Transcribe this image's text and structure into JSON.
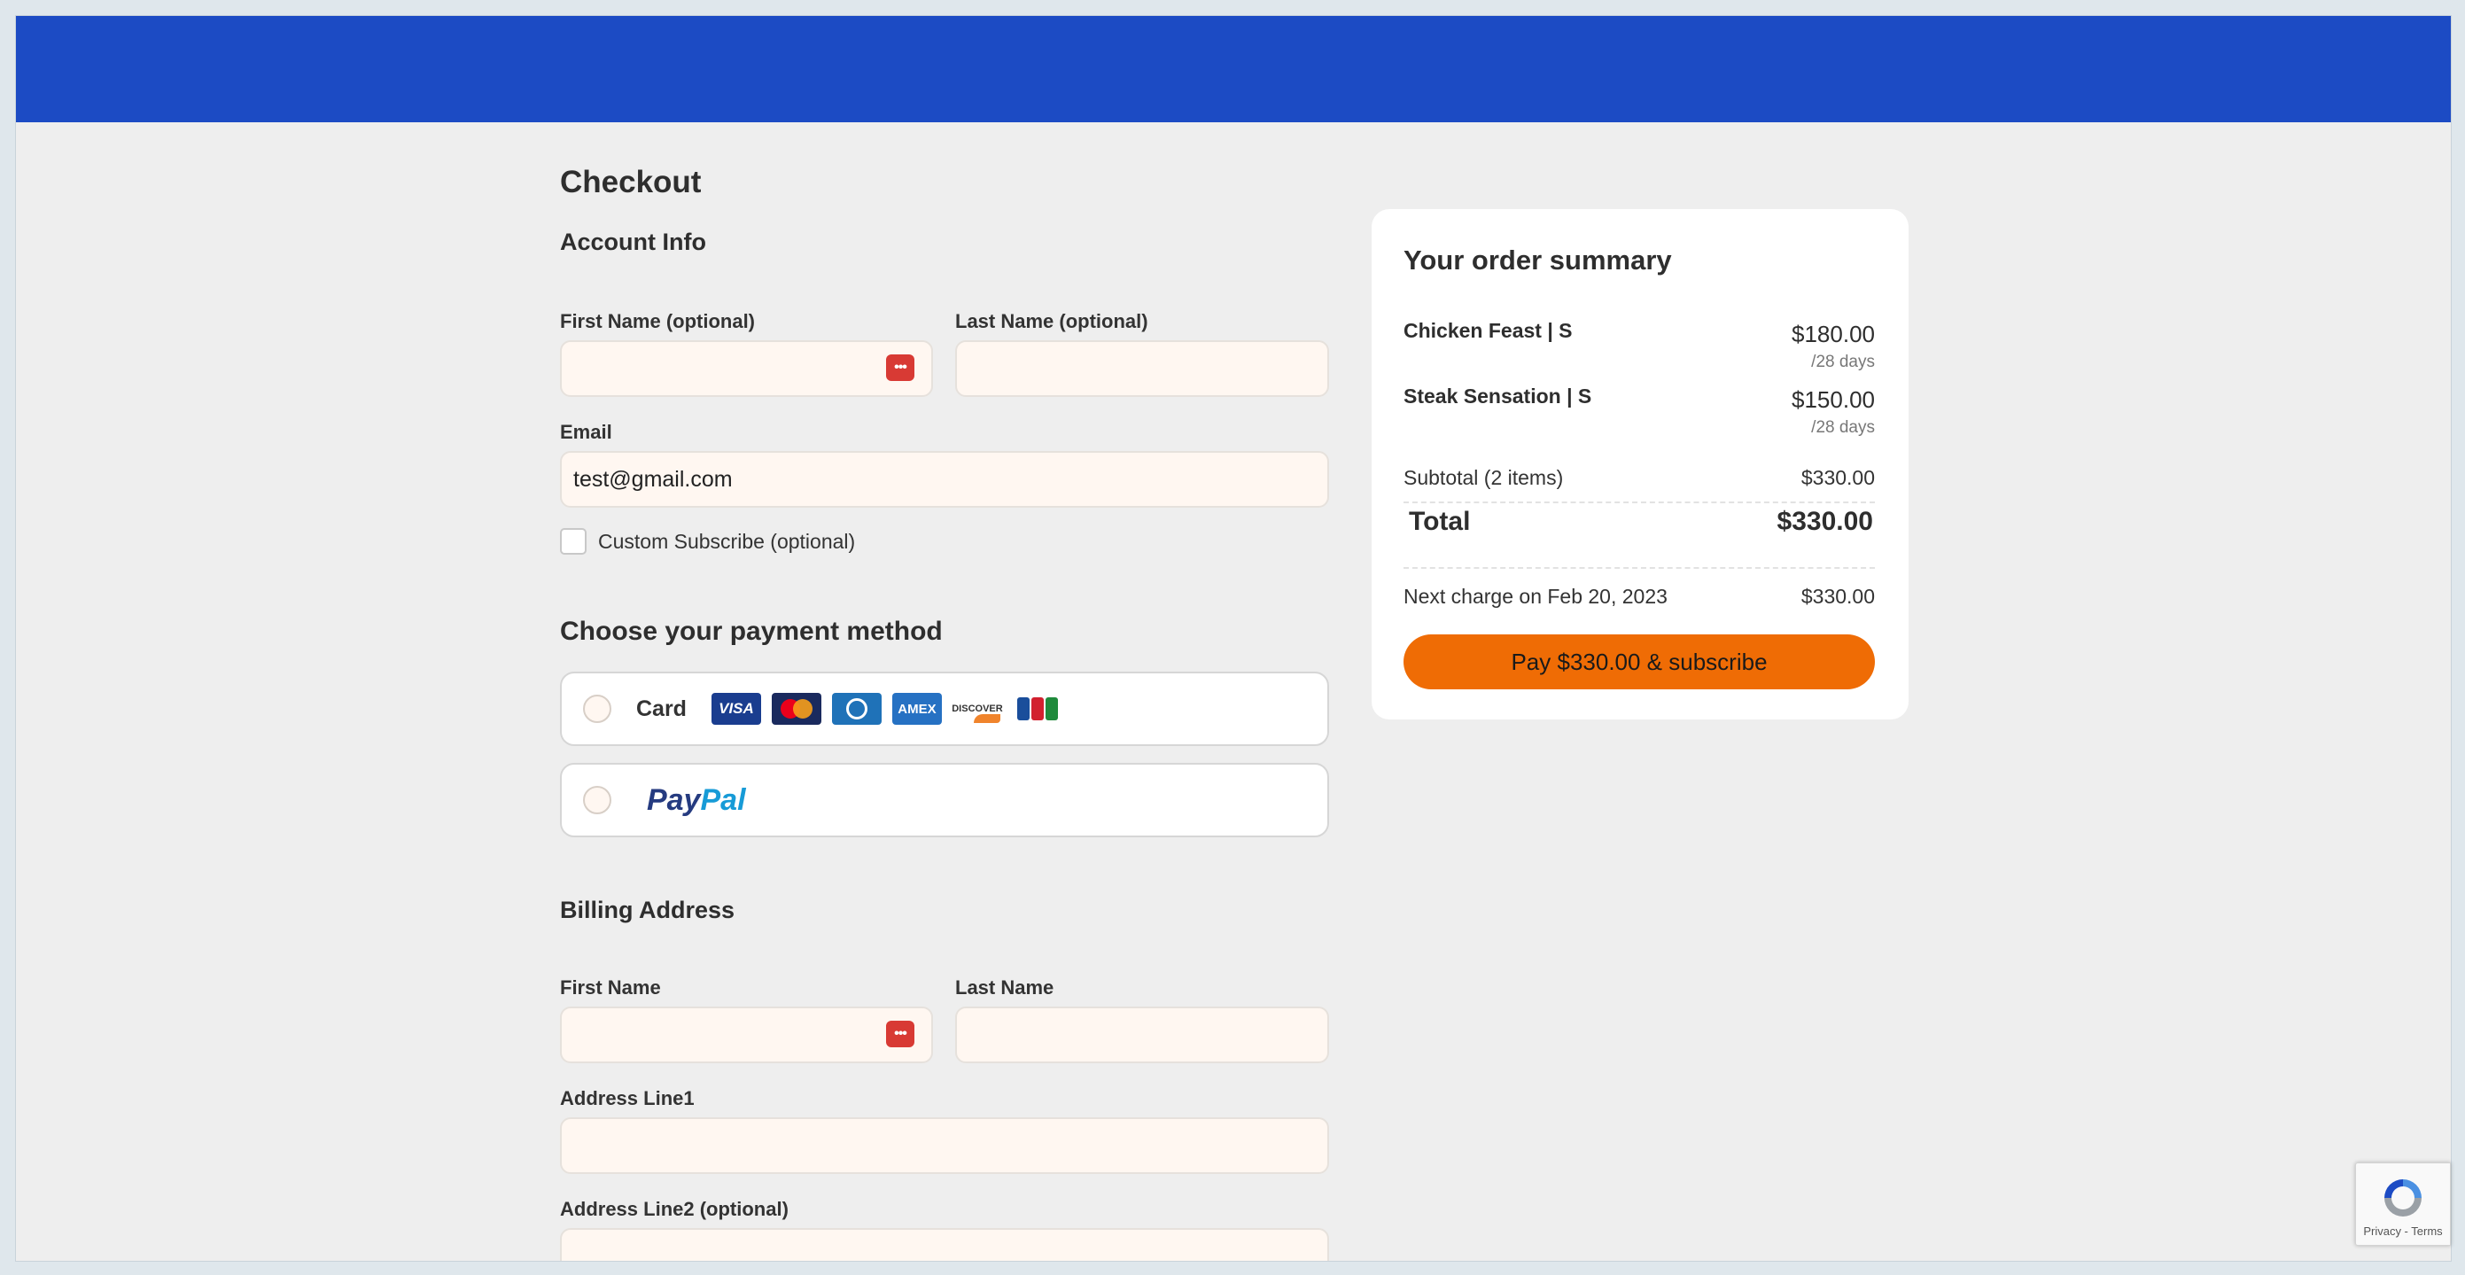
{
  "checkout": {
    "title": "Checkout",
    "account_info": {
      "heading": "Account Info",
      "first_name_label": "First Name (optional)",
      "first_name_value": "",
      "last_name_label": "Last Name (optional)",
      "last_name_value": "",
      "email_label": "Email",
      "email_value": "test@gmail.com",
      "subscribe_label": "Custom Subscribe (optional)",
      "subscribe_checked": false
    },
    "payment": {
      "heading": "Choose your payment method",
      "card_label": "Card",
      "card_brands": [
        "VISA",
        "Mastercard",
        "Diners Club",
        "AMEX",
        "DISCOVER",
        "JCB"
      ],
      "visa_text": "VISA",
      "amex_text": "AMEX",
      "discover_text": "DISCOVER",
      "paypal_part1": "Pay",
      "paypal_part2": "Pal"
    },
    "billing": {
      "heading": "Billing Address",
      "first_name_label": "First Name",
      "last_name_label": "Last Name",
      "address1_label": "Address Line1",
      "address2_label": "Address Line2 (optional)"
    }
  },
  "summary": {
    "title": "Your order summary",
    "items": [
      {
        "name": "Chicken Feast | S",
        "price": "$180.00",
        "period": "/28 days"
      },
      {
        "name": "Steak Sensation | S",
        "price": "$150.00",
        "period": "/28 days"
      }
    ],
    "subtotal_label": "Subtotal (2 items)",
    "subtotal_value": "$330.00",
    "total_label": "Total",
    "total_value": "$330.00",
    "next_charge_label": "Next charge on Feb 20, 2023",
    "next_charge_value": "$330.00",
    "pay_button": "Pay $330.00 & subscribe"
  },
  "recaptcha": {
    "footer": "Privacy - Terms"
  },
  "colors": {
    "header": "#1c4bc4",
    "accent_button": "#ef6c05",
    "page_background": "#eeeeee"
  }
}
